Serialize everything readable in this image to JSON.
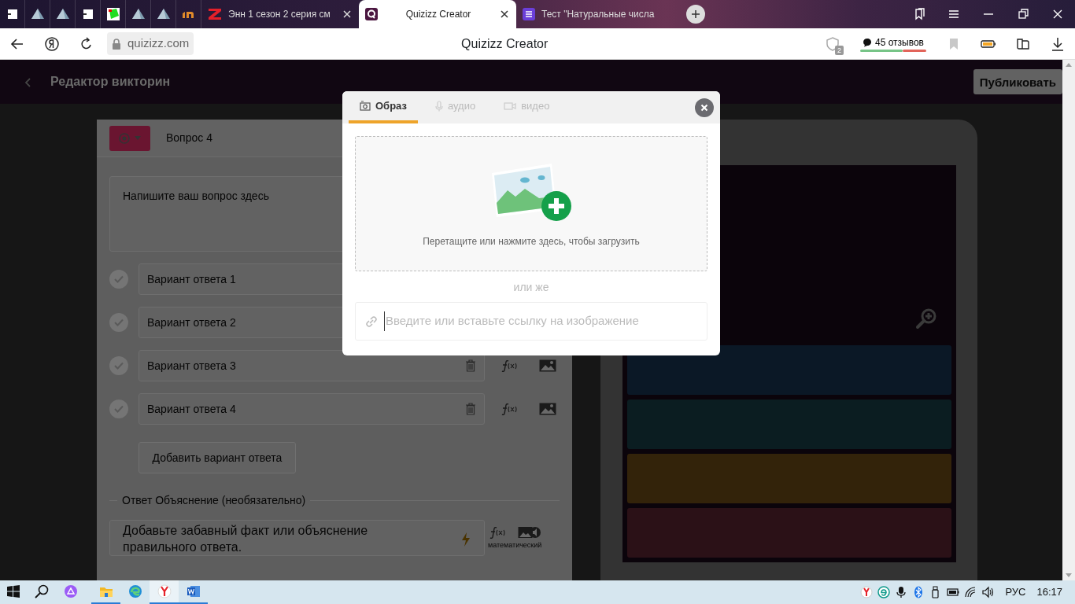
{
  "browser": {
    "tabs": [
      {
        "kind": "pinned",
        "selected": false
      },
      {
        "kind": "pinned",
        "selected": false
      },
      {
        "kind": "pinned",
        "selected": false
      },
      {
        "kind": "pinned",
        "selected": false
      },
      {
        "kind": "pinned",
        "selected": false
      },
      {
        "kind": "pinned",
        "selected": false
      },
      {
        "kind": "pinned",
        "selected": false
      },
      {
        "kind": "pinned",
        "selected": false
      },
      {
        "kind": "page",
        "title": "Энн 1 сезон 2 серия см",
        "selected": false,
        "closable": true
      },
      {
        "kind": "page",
        "title": "Quizizz Creator",
        "selected": true,
        "closable": true
      },
      {
        "kind": "page",
        "title": "Тест \"Натуральные числа",
        "selected": false,
        "closable": false
      }
    ],
    "address": "quizizz.com",
    "page_title": "Quizizz Creator",
    "shield_count": "2",
    "reviews": "45 отзывов"
  },
  "header": {
    "title": "Редактор викторин",
    "publish": "Публиковать"
  },
  "editor": {
    "question_label": "Вопрос 4",
    "question_placeholder": "Напишите ваш вопрос здесь",
    "options": [
      {
        "placeholder": "Вариант ответа 1",
        "kind": "plain"
      },
      {
        "placeholder": "Вариант ответа 2",
        "kind": "plain"
      },
      {
        "placeholder": "Вариант ответа 3",
        "kind": "tools"
      },
      {
        "placeholder": "Вариант ответа 4",
        "kind": "tools"
      }
    ],
    "add_option": "Добавить вариант ответа",
    "explanation_legend": "Ответ Объяснение (необязательно)",
    "explanation_placeholder": "Добавьте забавный факт или объяснение правильного ответа.",
    "math_label": "математический"
  },
  "preview": {
    "answers": [
      {
        "color": "#0b1826"
      },
      {
        "color": "#0b1d21"
      },
      {
        "color": "#33230a"
      },
      {
        "color": "#2b1117"
      }
    ]
  },
  "modal": {
    "tabs": [
      {
        "label": "Образ",
        "selected": true
      },
      {
        "label": "аудио",
        "selected": false
      },
      {
        "label": "видео",
        "selected": false
      }
    ],
    "drop_text": "Перетащите или нажмите здесь, чтобы загрузить",
    "or_text": "или же",
    "url_placeholder": "Введите или вставьте ссылку на изображение"
  },
  "taskbar": {
    "apps": [
      {
        "running": true,
        "selected": false
      },
      {
        "running": false,
        "selected": false
      },
      {
        "running": true,
        "selected": true
      },
      {
        "running": true,
        "selected": false
      }
    ],
    "language": "РУС",
    "time": "16:17"
  }
}
